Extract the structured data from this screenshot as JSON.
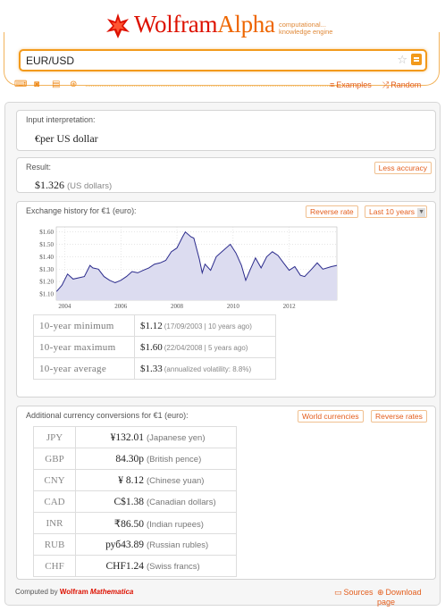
{
  "header": {
    "logo_wolfram": "Wolfram",
    "logo_alpha": "Alpha",
    "tagline_line1": "computational...",
    "tagline_line2": "knowledge engine"
  },
  "search": {
    "value": "EUR/USD"
  },
  "toolbar": {
    "icons": [
      "keyboard-icon",
      "camera-icon",
      "data-input-icon",
      "extended-keyboard-icon"
    ],
    "examples_label": "Examples",
    "random_label": "Random"
  },
  "pods": {
    "interpretation": {
      "title": "Input interpretation:",
      "value": "€per US dollar"
    },
    "result": {
      "title": "Result:",
      "value": "$1.326",
      "unit": "(US dollars)",
      "button": "Less accuracy"
    },
    "history": {
      "title": "Exchange history for €1 (euro):",
      "button_reverse": "Reverse rate",
      "button_range": "Last 10 years",
      "stats": [
        {
          "label": "10-year  minimum",
          "value": "$1.12",
          "note": "(17/09/2003 | 10 years ago)"
        },
        {
          "label": "10-year  maximum",
          "value": "$1.60",
          "note": "(22/04/2008 | 5 years ago)"
        },
        {
          "label": "10-year  average",
          "value": "$1.33",
          "note": "(annualized volatility: 8.8%)"
        }
      ]
    },
    "conversions": {
      "title": "Additional currency conversions for €1 (euro):",
      "button_world": "World currencies",
      "button_reverse": "Reverse rates",
      "rows": [
        {
          "code": "JPY",
          "amount": "¥132.01",
          "desc": "(Japanese yen)"
        },
        {
          "code": "GBP",
          "amount": "84.30p",
          "desc": "(British pence)"
        },
        {
          "code": "CNY",
          "amount": "¥ 8.12",
          "desc": "(Chinese yuan)"
        },
        {
          "code": "CAD",
          "amount": "C$1.38",
          "desc": "(Canadian dollars)"
        },
        {
          "code": "INR",
          "amount": "₹86.50",
          "desc": "(Indian rupees)"
        },
        {
          "code": "RUB",
          "amount": "руб43.89",
          "desc": "(Russian rubles)"
        },
        {
          "code": "CHF",
          "amount": "CHF1.24",
          "desc": "(Swiss francs)"
        }
      ]
    }
  },
  "footer": {
    "computed_by": "Computed by",
    "brand_wolfram": "Wolfram",
    "brand_mathematica": "Mathematica",
    "sources_label": "Sources",
    "download_label": "Download page"
  },
  "chart_data": {
    "type": "line",
    "title": "",
    "xlabel": "",
    "ylabel": "",
    "x_ticks": [
      "2004",
      "2006",
      "2008",
      "2010",
      "2012"
    ],
    "y_ticks": [
      "$1.10",
      "$1.20",
      "$1.30",
      "$1.40",
      "$1.50",
      "$1.60"
    ],
    "xlim": [
      2003.7,
      2013.7
    ],
    "ylim": [
      1.05,
      1.64
    ],
    "grid": true,
    "series": [
      {
        "color": "#2b2b8c",
        "x": [
          2003.71,
          2003.9,
          2004.1,
          2004.3,
          2004.5,
          2004.7,
          2004.9,
          2005.0,
          2005.2,
          2005.4,
          2005.6,
          2005.8,
          2006.0,
          2006.2,
          2006.4,
          2006.6,
          2006.8,
          2007.0,
          2007.2,
          2007.4,
          2007.6,
          2007.8,
          2008.0,
          2008.2,
          2008.3,
          2008.5,
          2008.6,
          2008.8,
          2008.9,
          2009.0,
          2009.2,
          2009.4,
          2009.6,
          2009.9,
          2010.1,
          2010.3,
          2010.45,
          2010.6,
          2010.8,
          2011.0,
          2011.2,
          2011.4,
          2011.6,
          2011.8,
          2012.0,
          2012.2,
          2012.4,
          2012.55,
          2012.8,
          2013.0,
          2013.2,
          2013.5,
          2013.7
        ],
        "y": [
          1.12,
          1.17,
          1.26,
          1.22,
          1.23,
          1.24,
          1.33,
          1.31,
          1.3,
          1.24,
          1.21,
          1.19,
          1.21,
          1.24,
          1.28,
          1.27,
          1.29,
          1.31,
          1.34,
          1.35,
          1.37,
          1.44,
          1.47,
          1.56,
          1.6,
          1.56,
          1.55,
          1.38,
          1.27,
          1.34,
          1.29,
          1.4,
          1.44,
          1.5,
          1.43,
          1.33,
          1.21,
          1.29,
          1.39,
          1.31,
          1.4,
          1.44,
          1.41,
          1.35,
          1.29,
          1.32,
          1.25,
          1.24,
          1.3,
          1.35,
          1.3,
          1.32,
          1.33
        ]
      }
    ]
  }
}
